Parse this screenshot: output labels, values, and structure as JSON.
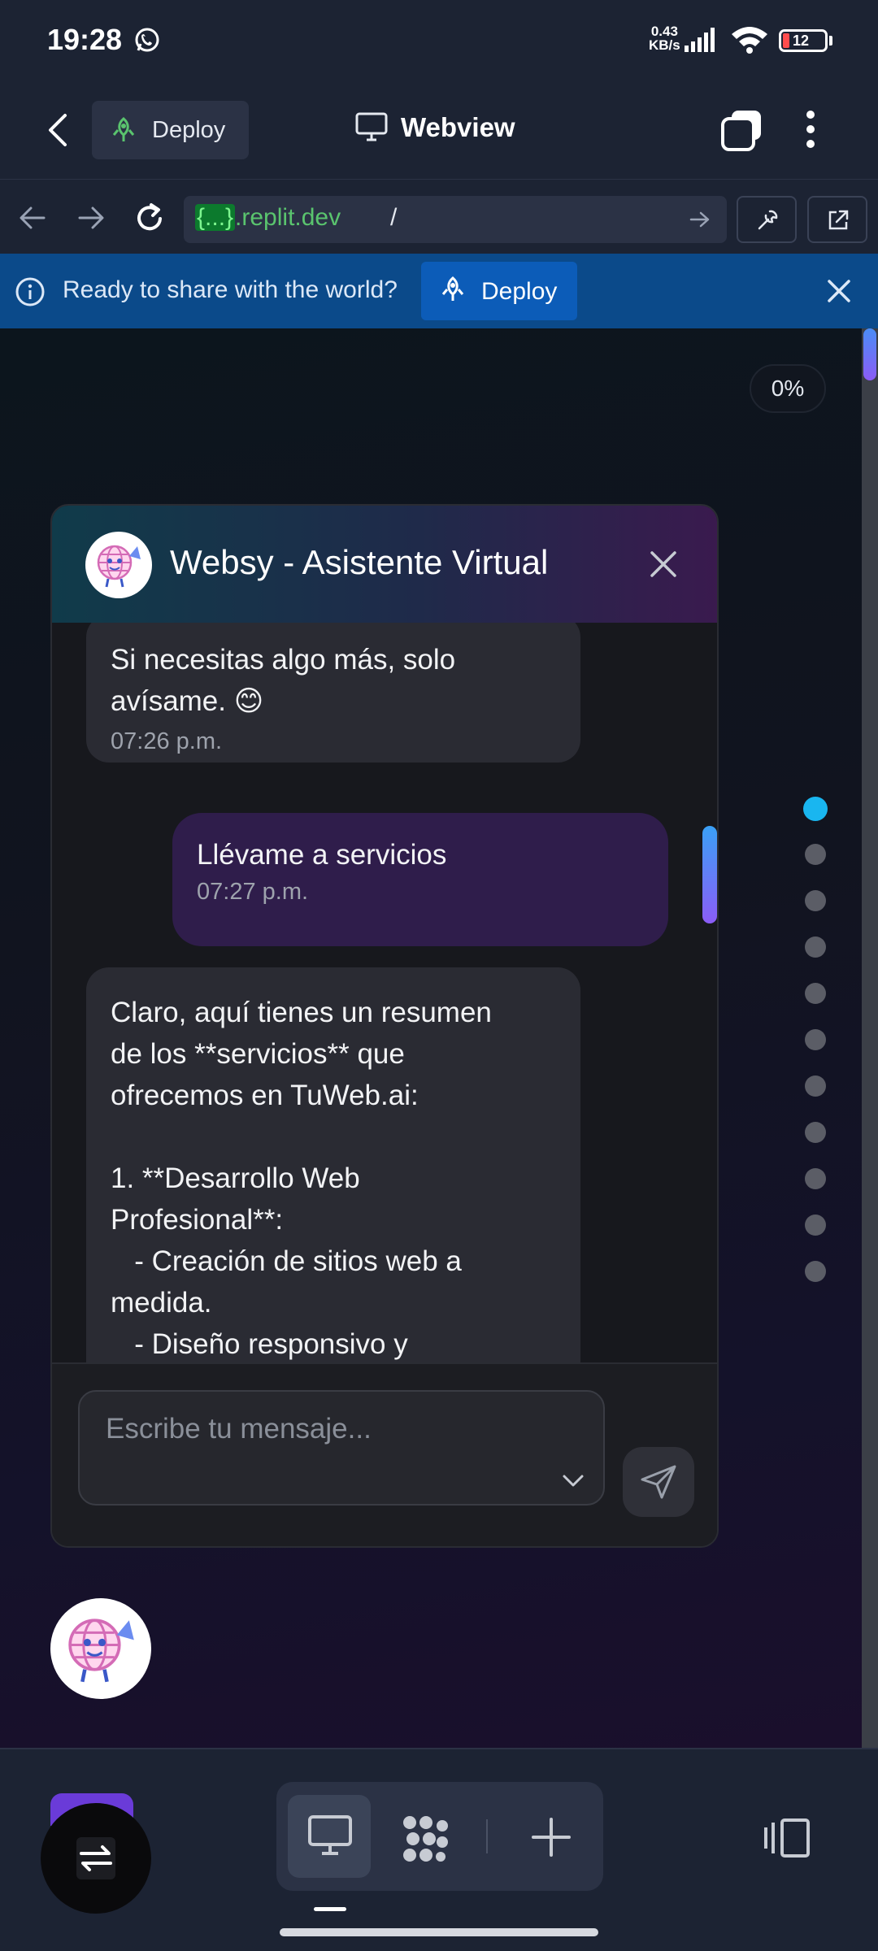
{
  "status_bar": {
    "time": "19:28",
    "net_speed_value": "0.43",
    "net_speed_unit": "KB/s",
    "battery": "12"
  },
  "header": {
    "deploy_label": "Deploy",
    "title": "Webview"
  },
  "url_bar": {
    "host_braces": "{...}",
    "host_domain": ".replit.dev",
    "path": "/"
  },
  "banner": {
    "text": "Ready to share with the world?",
    "deploy_label": "Deploy"
  },
  "page": {
    "scroll_percent": "0%",
    "pagination_total": 11,
    "pagination_active_index": 0
  },
  "chat": {
    "title": "Websy - Asistente Virtual",
    "messages": [
      {
        "from": "bot",
        "text": "Si necesitas algo más, solo\navísame. 😊",
        "time": "07:26 p.m."
      },
      {
        "from": "user",
        "text": "Llévame a servicios",
        "time": "07:27 p.m."
      },
      {
        "from": "bot",
        "text": "Claro, aquí tienes un resumen\nde los **servicios** que\nofrecemos en TuWeb.ai:\n\n1. **Desarrollo Web\nProfesional**:\n   - Creación de sitios web a\nmedida.\n   - Diseño responsivo y",
        "time": ""
      }
    ],
    "input_placeholder": "Escribe tu mensaje..."
  },
  "colors": {
    "accent_blue": "#19b6f0",
    "user_bubble": "#2f1d4b",
    "bot_bubble": "#2a2b33",
    "banner_bg": "#0b4a8a",
    "url_green": "#5ac46e"
  }
}
